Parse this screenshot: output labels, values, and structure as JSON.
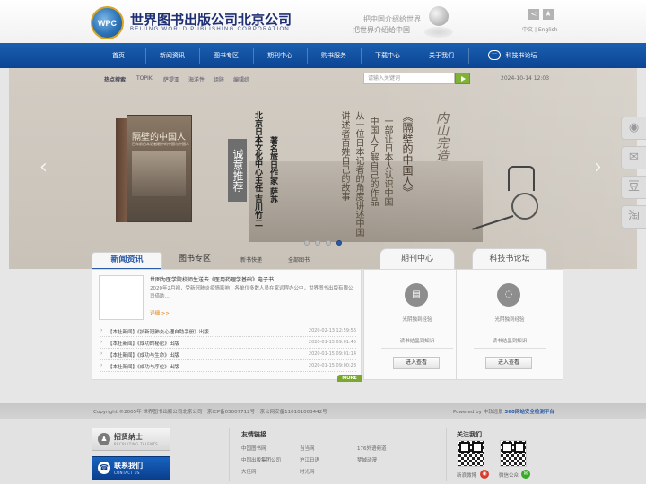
{
  "header": {
    "logo_text": "WPC",
    "name_cn": "世界图书出版公司北京公司",
    "name_en": "BEIJING WORLD PUBLISHING CORPORATION",
    "slogan_1": "把中国介绍给世界",
    "slogan_2": "把世界介绍给中国",
    "lang_cn": "中文",
    "lang_sep": "|",
    "lang_en": "English"
  },
  "nav": {
    "items": [
      "首页",
      "新闻资讯",
      "图书专区",
      "期刊中心",
      "购书服务",
      "下载中心",
      "关于我们",
      "科技书论坛"
    ]
  },
  "hot_search": {
    "label": "热点搜索：",
    "items": [
      "TOPIK",
      "萨提亚",
      "海洋性",
      "组胚",
      "编辑综"
    ],
    "placeholder": "请输入关键词",
    "date": "2024-10-14 12:03"
  },
  "banner": {
    "book_title": "隔壁的中国人",
    "book_subtitle": "百年前日本记者眼中的中国与中国人",
    "seal_text": "诚意推荐",
    "author_line_1": "北京日本文化中心主任 吉川竹二",
    "author_line_2": "著名旅日作家 萨苏",
    "desc_line_1": "《隔壁的中国人》",
    "desc_line_2": "一部让日本人认识中国",
    "desc_line_3": "中国人了解自己的作品",
    "desc_line_4": "从一位日本记者的角度讲述中国",
    "desc_line_5": "讲述者百姓自己的故事",
    "calligraphy": "内山完造",
    "active_slide": 4
  },
  "news": {
    "tab_news": "新闻资讯",
    "tab_books": "图书专区",
    "subtab_1": "新书快递",
    "subtab_2": "全部图书",
    "featured_title": "世图为医学院校师生送去《医用药理学基础》电子书",
    "featured_desc": "2020年2月初，受新冠肺炎疫情影响，各单位多数人员在家远程办公中，世界图书出版有限公司借助...",
    "detail_link": "详细 >>",
    "rows": [
      {
        "text": "【本社新闻】《抗新冠肺炎心理自助手册》出版",
        "date": "2020-02-13 12:59:56"
      },
      {
        "text": "【本社新闻】《成功的秘密》出版",
        "date": "2020-01-15 09:01:45"
      },
      {
        "text": "【本社新闻】《成功与生命》出版",
        "date": "2020-01-15 09:01:14"
      },
      {
        "text": "【本社新闻】《成功与序位》出版",
        "date": "2020-01-15 09:00:23"
      }
    ],
    "more": "MORE"
  },
  "journal": {
    "title": "期刊中心",
    "line_1": "光阴独到经验",
    "line_2": "读书结晶到知识",
    "button": "进入查看"
  },
  "forum": {
    "title": "科技书论坛",
    "line_1": "光阴独到经验",
    "line_2": "读书结晶到知识",
    "button": "进入查看"
  },
  "copyright": {
    "text": "Copyright ©2005年 世界图书出版公司北京公司　京ICP备05007712号　京公网安备110101003442号",
    "powered": "Powered by 中软远景",
    "powered_strong": "360网站安全检测平台"
  },
  "footer": {
    "recruit_title": "招贤纳士",
    "recruit_sub": "RECRUITING TALENTS",
    "contact_title": "联系我们",
    "contact_sub": "CONTACT US",
    "links_title": "友情链接",
    "links": [
      "中国图书网",
      "当当网",
      "176外语频道",
      "中国出版集团公司",
      "沪江日语",
      "梦城动漫",
      "大佳网",
      "时光网"
    ],
    "follow_title": "关注我们",
    "qr_1_caption": "新浪微博",
    "qr_2_caption": "微信公众"
  },
  "colors": {
    "nav": "#0c4594",
    "accent": "#2a5aa8",
    "more": "#7aa82f",
    "search_button": "#7fb235"
  }
}
